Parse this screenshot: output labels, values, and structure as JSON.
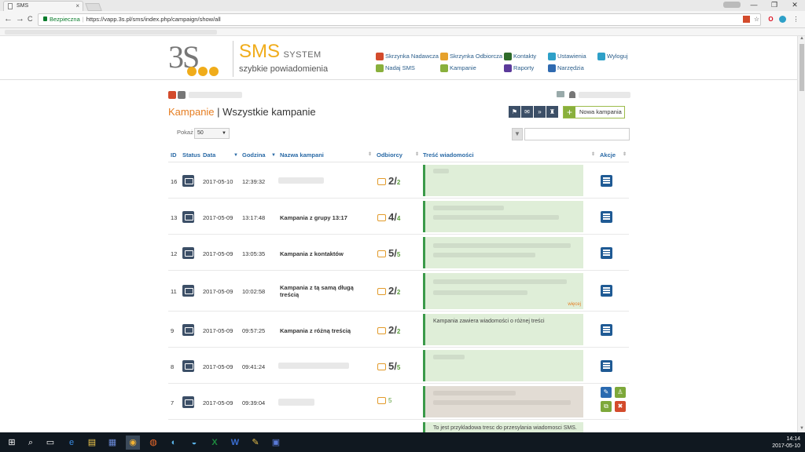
{
  "browser": {
    "tab_title": "SMS",
    "tab_close": "×",
    "window_controls": [
      "—",
      "❐",
      "✕"
    ],
    "nav": [
      "←",
      "→",
      "C"
    ],
    "secure_label": "Bezpieczna",
    "url": "https://vapp.3s.pl/sms/index.php/campaign/show/all",
    "right_icons": [
      "☆",
      "O",
      "⋮"
    ]
  },
  "brand": {
    "logo_text": "3S",
    "sms": "SMS",
    "system": "SYSTEM",
    "tagline": "szybkie powiadomienia"
  },
  "menu": [
    {
      "label": "Skrzynka Nadawcza",
      "color": "#d34b2c"
    },
    {
      "label": "Skrzynka Odbiorcza",
      "color": "#e6a12c"
    },
    {
      "label": "Kontakty",
      "color": "#2f6b2a"
    },
    {
      "label": "Ustawienia",
      "color": "#2ea0c8"
    },
    {
      "label": "Wyloguj",
      "color": "#2ea0c8"
    },
    {
      "label": "Nadaj SMS",
      "color": "#89b03c"
    },
    {
      "label": "Kampanie",
      "color": "#89b03c"
    },
    {
      "label": "Raporty",
      "color": "#5b3a9a"
    },
    {
      "label": "Narzędzia",
      "color": "#2f6ab0"
    }
  ],
  "page": {
    "title_part1": "Kampanie",
    "title_sep": " | ",
    "title_part2": "Wszystkie kampanie",
    "new_campaign": "Nowa kampania",
    "show_label": "Pokaż",
    "show_value": "50"
  },
  "columns": {
    "id": "ID",
    "status": "Status",
    "date": "Data",
    "time": "Godzina",
    "name": "Nazwa kampani",
    "recipients": "Odbiorcy",
    "content": "Treść wiadomości",
    "actions": "Akcje"
  },
  "rows": [
    {
      "id": "16",
      "date": "2017-05-10",
      "time": "12:39:32",
      "name": "",
      "sent": "2",
      "total": "2",
      "msg": "",
      "more": ""
    },
    {
      "id": "13",
      "date": "2017-05-09",
      "time": "13:17:48",
      "name": "Kampania z grupy 13:17",
      "sent": "4",
      "total": "4",
      "msg": "",
      "more": ""
    },
    {
      "id": "12",
      "date": "2017-05-09",
      "time": "13:05:35",
      "name": "Kampania z kontaktów",
      "sent": "5",
      "total": "5",
      "msg": "",
      "more": ""
    },
    {
      "id": "11",
      "date": "2017-05-09",
      "time": "10:02:58",
      "name": "Kampania z tą samą długą treścią",
      "sent": "2",
      "total": "2",
      "msg": "",
      "more": "więcej"
    },
    {
      "id": "9",
      "date": "2017-05-09",
      "time": "09:57:25",
      "name": "Kampania z różną treścią",
      "sent": "2",
      "total": "2",
      "msg": "Kampania zawiera wiadomości o różnej treści",
      "more": ""
    },
    {
      "id": "8",
      "date": "2017-05-09",
      "time": "09:41:24",
      "name": "",
      "sent": "5",
      "total": "5",
      "msg": "",
      "more": ""
    },
    {
      "id": "7",
      "date": "2017-05-09",
      "time": "09:39:04",
      "name": "",
      "sent": "5",
      "total": "",
      "msg": "",
      "more": ""
    },
    {
      "id": "",
      "date": "",
      "time": "",
      "name": "",
      "sent": "",
      "total": "",
      "msg": "To jest przykladowa tresc do przesylania wiadomosci SMS.",
      "more": ""
    }
  ],
  "taskbar": {
    "time": "14:14",
    "date": "2017-05-10"
  }
}
